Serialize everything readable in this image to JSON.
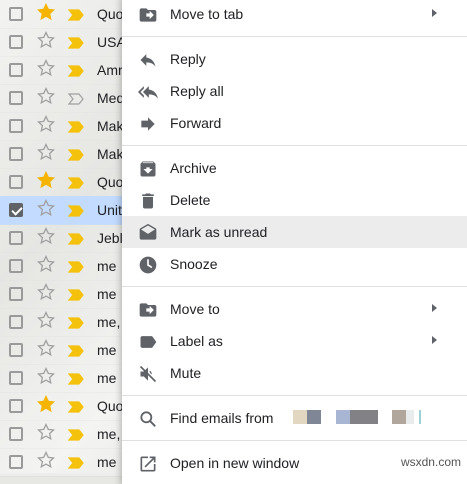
{
  "email_list": {
    "rows": [
      {
        "sender": "Quo",
        "starred": true,
        "important": true,
        "checked": false,
        "selected": false
      },
      {
        "sender": "USA",
        "starred": false,
        "important": true,
        "checked": false,
        "selected": false
      },
      {
        "sender": "Amr",
        "starred": false,
        "important": true,
        "checked": false,
        "selected": false
      },
      {
        "sender": "Med",
        "starred": false,
        "important": false,
        "checked": false,
        "selected": false
      },
      {
        "sender": "Mak",
        "starred": false,
        "important": true,
        "checked": false,
        "selected": false
      },
      {
        "sender": "Mak",
        "starred": false,
        "important": true,
        "checked": false,
        "selected": false
      },
      {
        "sender": "Quo",
        "starred": true,
        "important": true,
        "checked": false,
        "selected": false
      },
      {
        "sender": "Unit",
        "starred": false,
        "important": true,
        "checked": true,
        "selected": true
      },
      {
        "sender": "Jebl",
        "starred": false,
        "important": true,
        "checked": false,
        "selected": false
      },
      {
        "sender": "me",
        "starred": false,
        "important": true,
        "checked": false,
        "selected": false
      },
      {
        "sender": "me",
        "starred": false,
        "important": true,
        "checked": false,
        "selected": false
      },
      {
        "sender": "me,",
        "starred": false,
        "important": true,
        "checked": false,
        "selected": false
      },
      {
        "sender": "me",
        "starred": false,
        "important": true,
        "checked": false,
        "selected": false
      },
      {
        "sender": "me",
        "starred": false,
        "important": true,
        "checked": false,
        "selected": false
      },
      {
        "sender": "Quo",
        "starred": true,
        "important": true,
        "checked": false,
        "selected": false
      },
      {
        "sender": "me,",
        "starred": false,
        "important": true,
        "checked": false,
        "selected": false
      },
      {
        "sender": "me",
        "starred": false,
        "important": true,
        "checked": false,
        "selected": false
      }
    ]
  },
  "menu": {
    "move_to_tab": "Move to tab",
    "reply": "Reply",
    "reply_all": "Reply all",
    "forward": "Forward",
    "archive": "Archive",
    "delete": "Delete",
    "mark_as_unread": "Mark as unread",
    "snooze": "Snooze",
    "move_to": "Move to",
    "label_as": "Label as",
    "mute": "Mute",
    "find_emails_from": "Find emails from",
    "open_in_new_window": "Open in new window"
  },
  "colors": {
    "star": "#f4b400",
    "important": "#f4c20d",
    "selected_row": "#c2dbff",
    "menu_hover": "#ececec",
    "icon": "#5f6368"
  },
  "watermark": "wsxdn.com"
}
